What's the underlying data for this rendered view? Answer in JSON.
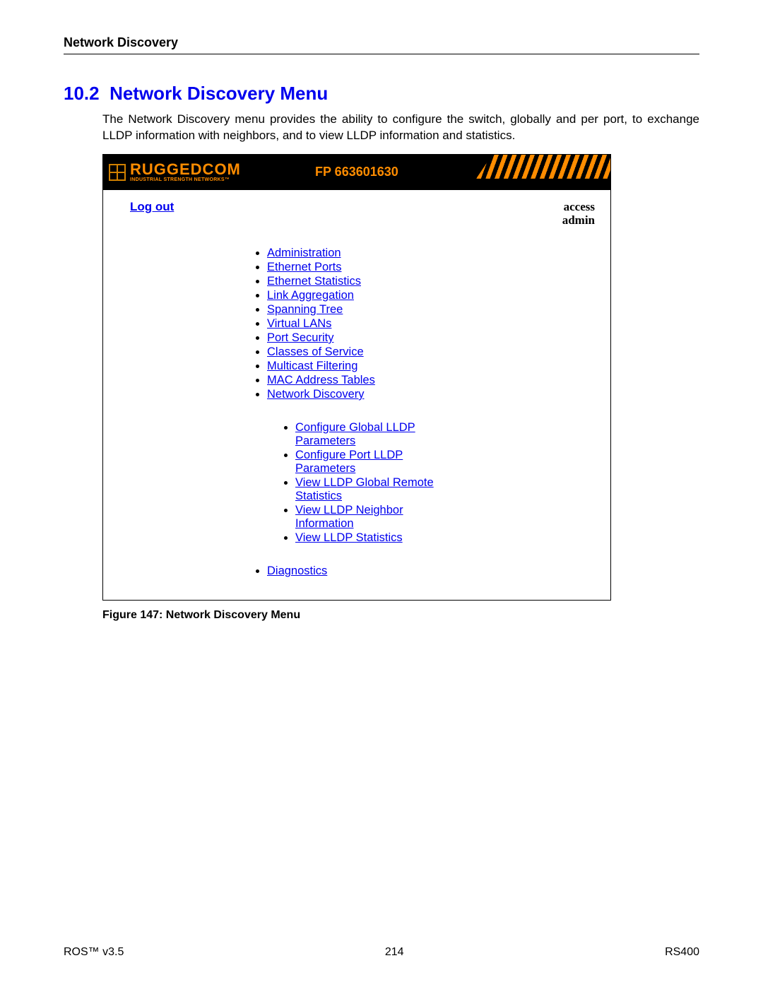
{
  "doc": {
    "chapter_head": "Network Discovery",
    "section_number": "10.2",
    "section_title": "Network Discovery Menu",
    "section_body": "The Network Discovery menu provides the ability to configure the switch, globally and per port, to exchange LLDP information with neighbors, and to view LLDP information and statistics.",
    "figure_caption": "Figure 147: Network Discovery Menu"
  },
  "ui": {
    "logo_main": "RUGGEDCOM",
    "logo_sub": "INDUSTRIAL STRENGTH NETWORKS™",
    "banner_title": "FP 663601630",
    "logout": "Log out",
    "access_line1": "access",
    "access_line2": "admin",
    "menu": [
      "Administration",
      "Ethernet Ports",
      "Ethernet Statistics",
      "Link Aggregation",
      "Spanning Tree",
      "Virtual LANs",
      "Port Security",
      "Classes of Service",
      "Multicast Filtering",
      "MAC Address Tables",
      "Network Discovery"
    ],
    "submenu": [
      "Configure Global LLDP Parameters",
      "Configure Port LLDP Parameters",
      "View LLDP Global Remote Statistics",
      "View LLDP Neighbor Information",
      "View LLDP Statistics"
    ],
    "menu_after": [
      "Diagnostics"
    ]
  },
  "footer": {
    "left": "ROS™  v3.5",
    "center": "214",
    "right": "RS400"
  }
}
